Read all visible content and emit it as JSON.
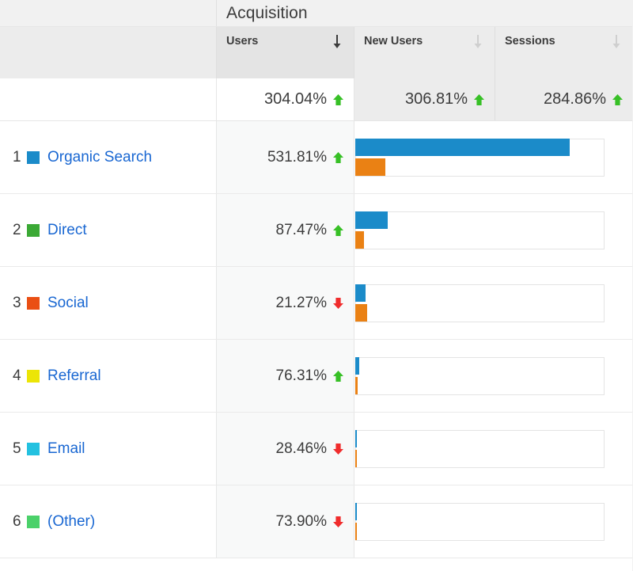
{
  "group_header": {
    "dimension_label": "",
    "acquisition_label": "Acquisition"
  },
  "columns": [
    {
      "key": "dimension",
      "label": "",
      "sort_icon": "",
      "sort_active": false
    },
    {
      "key": "users",
      "label": "Users",
      "sort_icon": "sort-descending-arrow-icon",
      "sort_active": true
    },
    {
      "key": "new_users",
      "label": "New Users",
      "sort_icon": "sort-descending-arrow-icon",
      "sort_active": false
    },
    {
      "key": "sessions",
      "label": "Sessions",
      "sort_icon": "sort-descending-arrow-icon",
      "sort_active": false
    }
  ],
  "summary": {
    "dimension": "",
    "users": {
      "value": "304.04%",
      "direction": "up",
      "icon": "arrow-up-icon"
    },
    "new_users": {
      "value": "306.81%",
      "direction": "up",
      "icon": "arrow-up-icon"
    },
    "sessions": {
      "value": "284.86%",
      "direction": "up",
      "icon": "arrow-up-icon"
    }
  },
  "rows": [
    {
      "rank": "1",
      "label": "Organic Search",
      "swatch_color": "#1b8bc9",
      "users_change": "531.81%",
      "direction": "up",
      "icon": "arrow-up-icon"
    },
    {
      "rank": "2",
      "label": "Direct",
      "swatch_color": "#3ba935",
      "users_change": "87.47%",
      "direction": "up",
      "icon": "arrow-up-icon"
    },
    {
      "rank": "3",
      "label": "Social",
      "swatch_color": "#ea4f14",
      "users_change": "21.27%",
      "direction": "down",
      "icon": "arrow-down-icon"
    },
    {
      "rank": "4",
      "label": "Referral",
      "swatch_color": "#ece506",
      "users_change": "76.31%",
      "direction": "up",
      "icon": "arrow-up-icon"
    },
    {
      "rank": "5",
      "label": "Email",
      "swatch_color": "#23c1e0",
      "users_change": "28.46%",
      "direction": "down",
      "icon": "arrow-down-icon"
    },
    {
      "rank": "6",
      "label": "(Other)",
      "swatch_color": "#4bd16a",
      "users_change": "73.90%",
      "direction": "down",
      "icon": "arrow-down-icon"
    }
  ],
  "colors": {
    "bar_primary": "#1b8bc9",
    "bar_secondary": "#ea8114",
    "up_arrow": "#37c026",
    "down_arrow": "#f02c2c",
    "link": "#1967d2",
    "header_bg": "#ececec",
    "active_col_bg": "#e4e4e4"
  },
  "chart_data": {
    "type": "bar",
    "title": "Acquisition",
    "orientation": "horizontal",
    "categories": [
      "Organic Search",
      "Direct",
      "Social",
      "Referral",
      "Email",
      "(Other)"
    ],
    "series": [
      {
        "name": "Users",
        "color": "#1b8bc9",
        "values": [
          85.9,
          13.1,
          4.1,
          1.6,
          0.6,
          0.6
        ]
      },
      {
        "name": "New Users",
        "color": "#ea8114",
        "values": [
          12.1,
          3.5,
          4.7,
          1.0,
          0.6,
          0.6
        ]
      }
    ],
    "value_unit": "percent_of_max_bar_width",
    "xlim": [
      0,
      100
    ],
    "xlabel": "",
    "ylabel": "",
    "grid": false,
    "legend": "none",
    "annotations": {
      "users_change_percent": [
        "531.81%",
        "87.47%",
        "21.27%",
        "76.31%",
        "28.46%",
        "73.90%"
      ],
      "users_change_direction": [
        "up",
        "up",
        "down",
        "up",
        "down",
        "down"
      ],
      "totals": {
        "Users": "304.04%",
        "New Users": "306.81%",
        "Sessions": "284.86%"
      }
    }
  }
}
